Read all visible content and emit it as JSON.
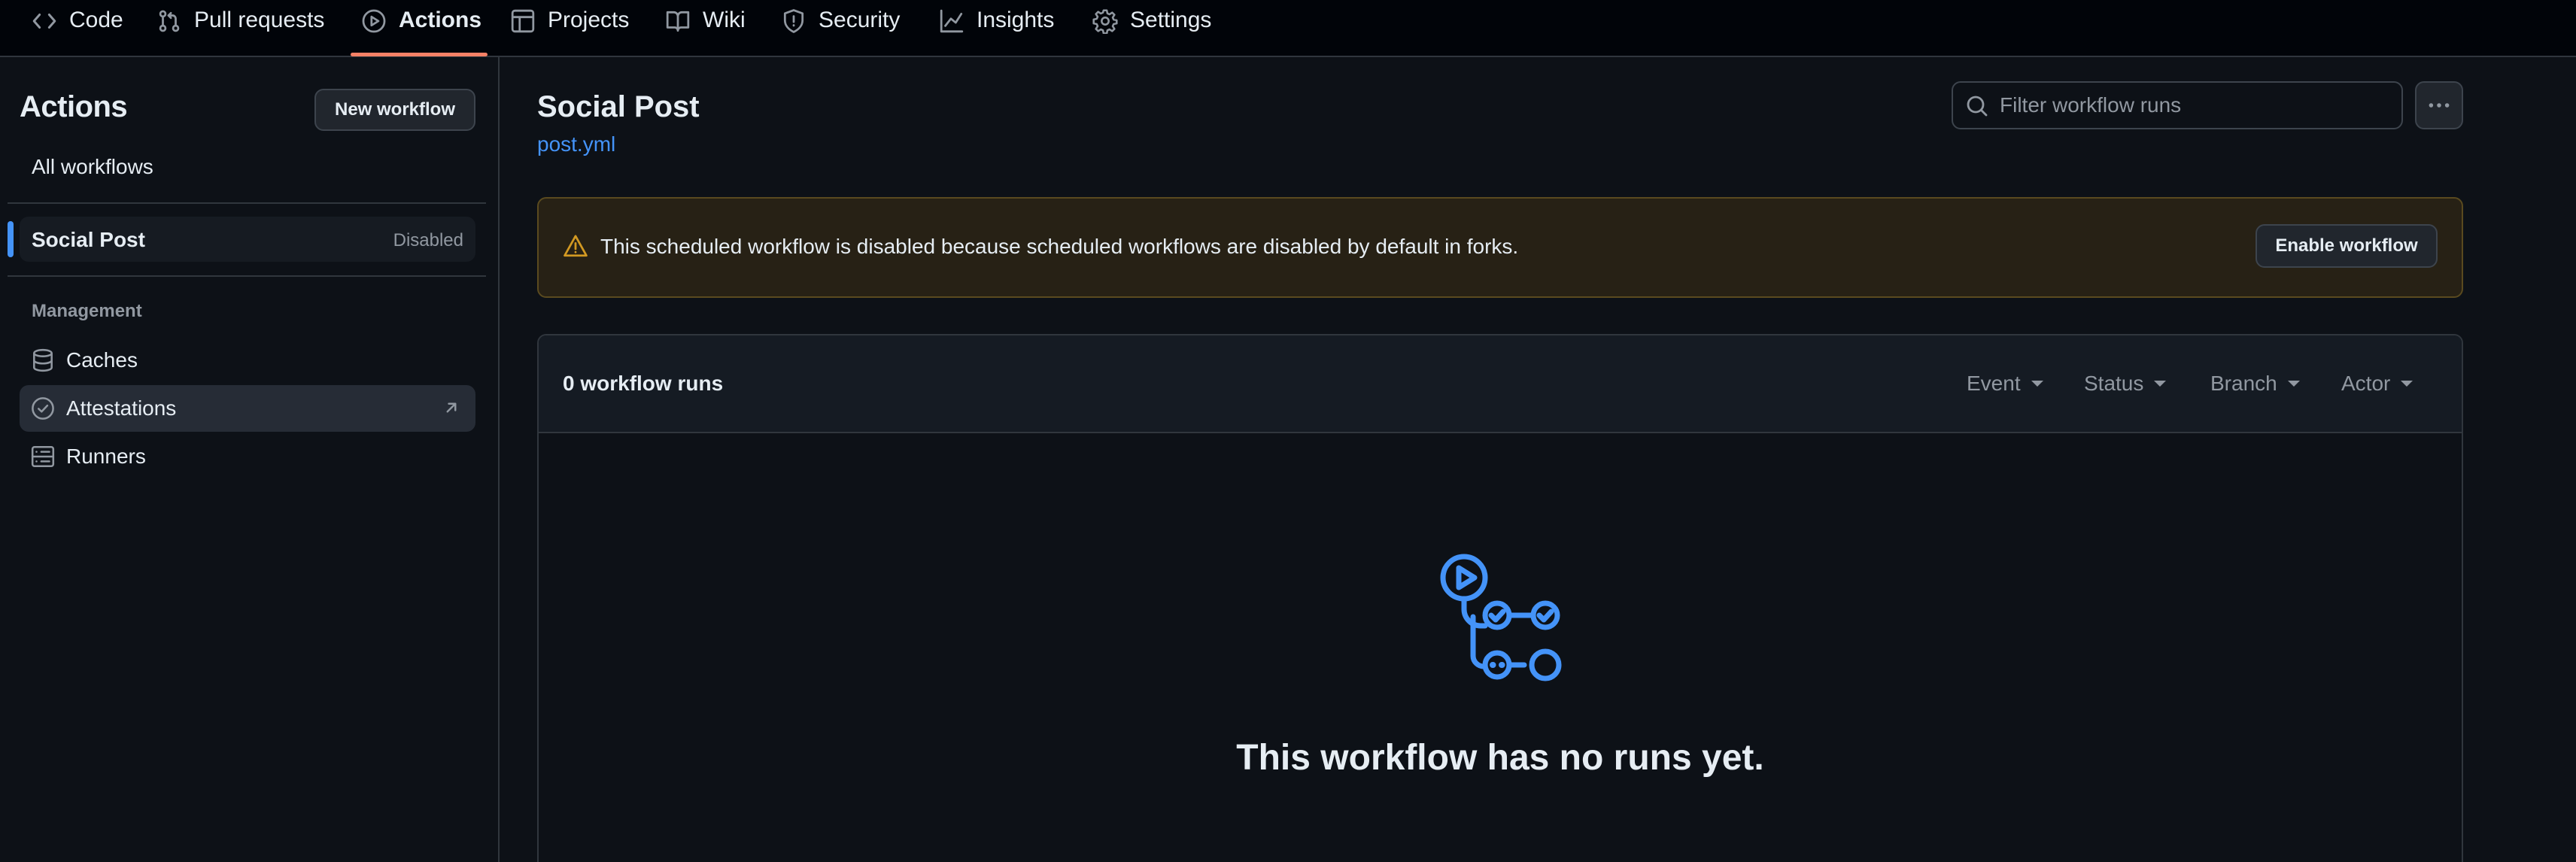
{
  "repo_nav": {
    "tabs": [
      {
        "label": "Code",
        "icon": "code-icon"
      },
      {
        "label": "Pull requests",
        "icon": "git-pull-request-icon"
      },
      {
        "label": "Actions",
        "icon": "play-icon",
        "selected": true
      },
      {
        "label": "Projects",
        "icon": "table-icon"
      },
      {
        "label": "Wiki",
        "icon": "book-icon"
      },
      {
        "label": "Security",
        "icon": "shield-icon"
      },
      {
        "label": "Insights",
        "icon": "graph-icon"
      },
      {
        "label": "Settings",
        "icon": "gear-icon"
      }
    ]
  },
  "sidebar": {
    "title": "Actions",
    "new_workflow_button": "New workflow",
    "all_workflows": "All workflows",
    "selected_workflow": {
      "label": "Social Post",
      "badge": "Disabled"
    },
    "management_heading": "Management",
    "management_items": [
      {
        "label": "Caches",
        "icon": "database-icon"
      },
      {
        "label": "Attestations",
        "icon": "verified-icon",
        "external": true
      },
      {
        "label": "Runners",
        "icon": "server-icon"
      }
    ]
  },
  "main": {
    "workflow_title": "Social Post",
    "workflow_file": "post.yml",
    "filter_placeholder": "Filter workflow runs",
    "banner": {
      "message": "This scheduled workflow is disabled because scheduled workflows are disabled by default in forks.",
      "button": "Enable workflow"
    },
    "runs": {
      "count_label": "0 workflow runs",
      "filters": [
        "Event",
        "Status",
        "Branch",
        "Actor"
      ],
      "empty_message": "This workflow has no runs yet."
    }
  },
  "colors": {
    "background": "#0d1117",
    "accent_link": "#4493f8",
    "tab_underline": "#f78166",
    "warning": "#d29922"
  }
}
